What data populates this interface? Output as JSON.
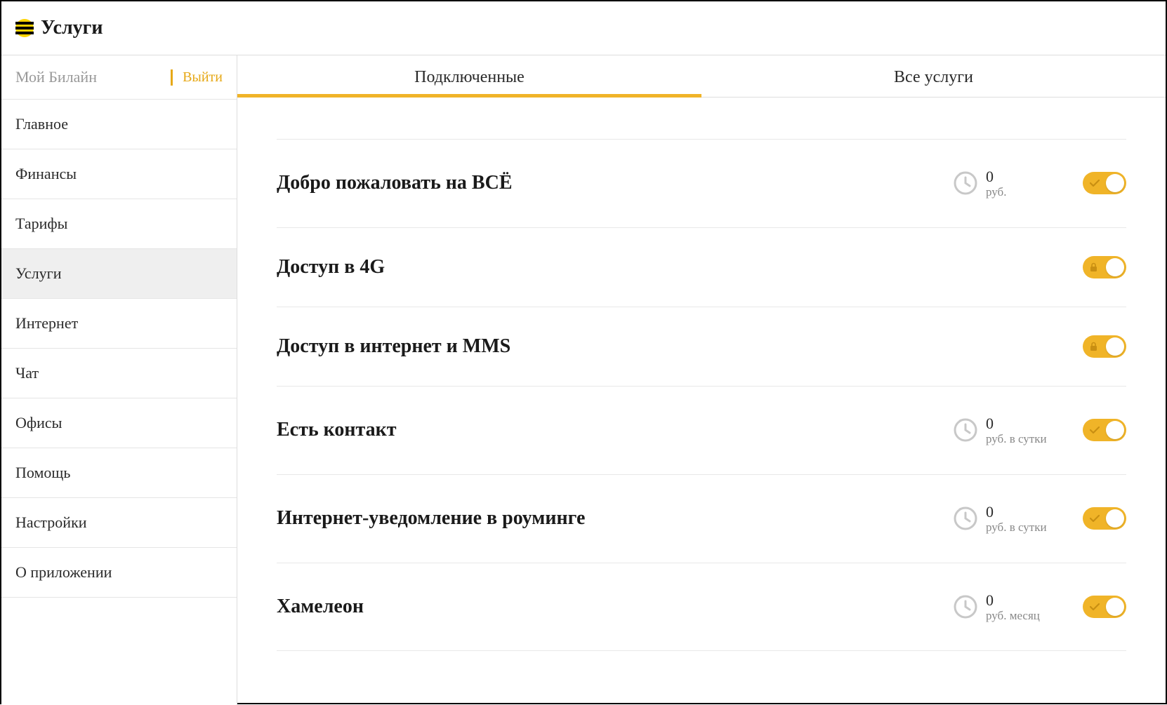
{
  "header": {
    "title": "Услуги"
  },
  "sidebar": {
    "brand": "Мой Билайн",
    "logout": "Выйти",
    "items": [
      {
        "label": "Главное",
        "active": false
      },
      {
        "label": "Финансы",
        "active": false
      },
      {
        "label": "Тарифы",
        "active": false
      },
      {
        "label": "Услуги",
        "active": true
      },
      {
        "label": "Интернет",
        "active": false
      },
      {
        "label": "Чат",
        "active": false
      },
      {
        "label": "Офисы",
        "active": false
      },
      {
        "label": "Помощь",
        "active": false
      },
      {
        "label": "Настройки",
        "active": false
      },
      {
        "label": "О приложении",
        "active": false
      }
    ]
  },
  "tabs": [
    {
      "label": "Подключенные",
      "active": true
    },
    {
      "label": "Все услуги",
      "active": false
    }
  ],
  "services": [
    {
      "title": "Добро пожаловать на ВСЁ",
      "price": "0",
      "unit": "руб.",
      "indicator": "check",
      "showPrice": true
    },
    {
      "title": "Доступ в 4G",
      "price": "",
      "unit": "",
      "indicator": "lock",
      "showPrice": false
    },
    {
      "title": "Доступ в интернет и MMS",
      "price": "",
      "unit": "",
      "indicator": "lock",
      "showPrice": false
    },
    {
      "title": "Есть контакт",
      "price": "0",
      "unit": "руб. в сутки",
      "indicator": "check",
      "showPrice": true
    },
    {
      "title": "Интернет-уведомление в роуминге",
      "price": "0",
      "unit": "руб. в сутки",
      "indicator": "check",
      "showPrice": true
    },
    {
      "title": "Хамелеон",
      "price": "0",
      "unit": "руб. месяц",
      "indicator": "check",
      "showPrice": true
    }
  ],
  "colors": {
    "accent": "#f0b428",
    "muted": "#c8c8c8"
  }
}
